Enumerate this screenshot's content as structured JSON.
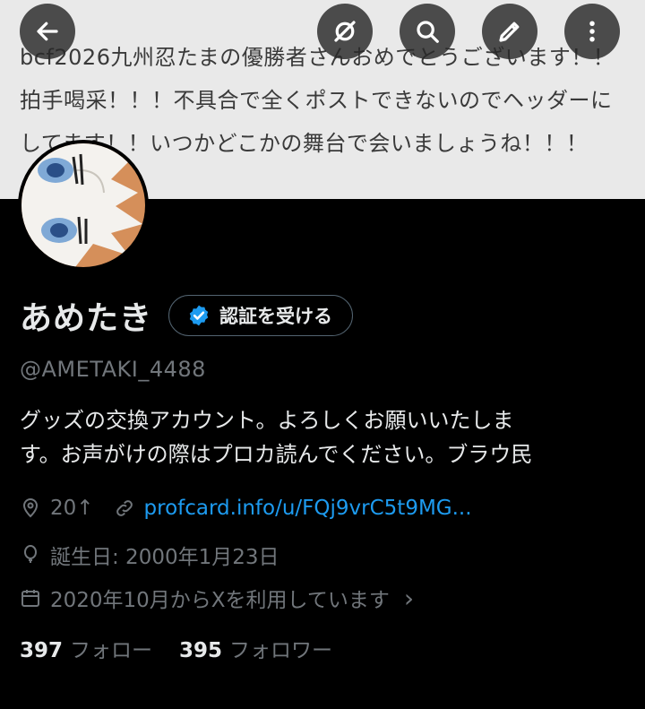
{
  "banner": {
    "text": "bcf2026九州忍たまの優勝者さんおめでとうございます！！\n拍手喝采！！！不具合で全くポストできないのでヘッダーに\nしてます！！いつかどこかの舞台で会いましょうね！！！"
  },
  "top_bar": {
    "buttons": [
      "back-icon",
      "hide-icon",
      "search-icon",
      "edit-icon",
      "more-icon"
    ]
  },
  "profile": {
    "name": "あめたき",
    "verify_label": "認証を受ける",
    "handle": "@AMETAKI_4488",
    "bio": "グッズの交換アカウント。よろしくお願いいたしま\nす。お声がけの際はプロカ読んでください。ブラウ民",
    "location": "20↑",
    "link": "profcard.info/u/FQj9vrC5t9MG...",
    "birthday": "誕生日: 2000年1月23日",
    "joined": "2020年10月からXを利用しています",
    "joined_chevron": "›",
    "following_count": "397",
    "following_label": "フォロー",
    "followers_count": "395",
    "followers_label": "フォロワー"
  },
  "colors": {
    "background": "#000000",
    "link": "#1d9bf0",
    "verified": "#1d9bf0",
    "muted": "#71767b"
  }
}
